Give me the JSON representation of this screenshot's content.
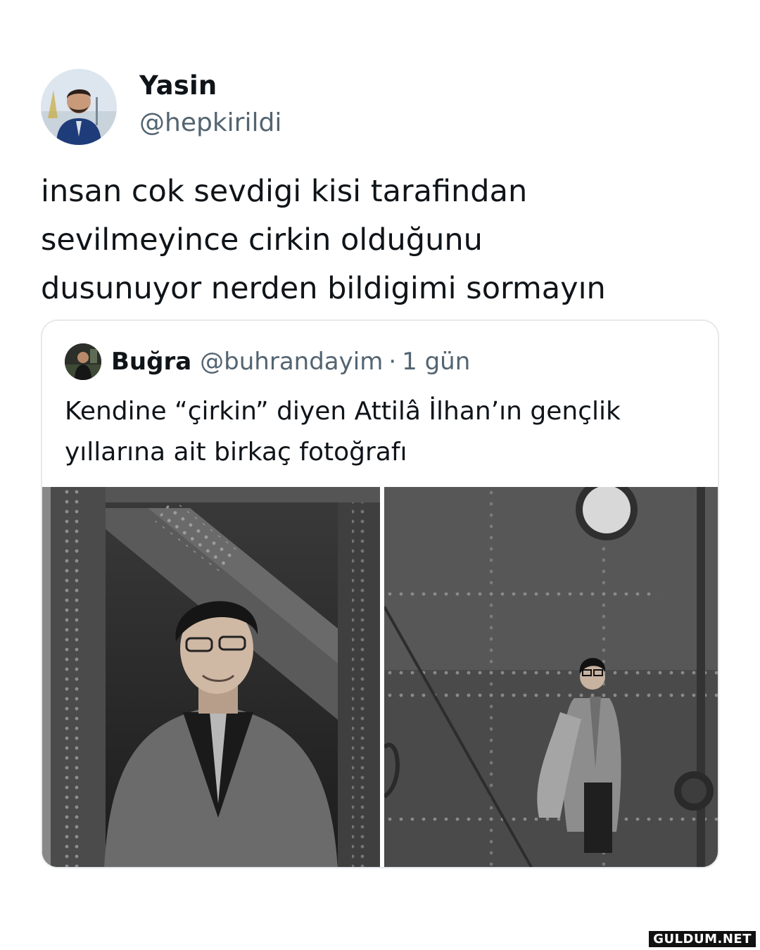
{
  "author": {
    "display_name": "Yasin",
    "handle": "@hepkirildi",
    "avatar_icon": "profile-photo"
  },
  "tweet": {
    "lines": [
      "insan cok sevdigi kisi tarafindan",
      "sevilmeyince cirkin olduğunu",
      "dusunuyor nerden bildigimi sormayın"
    ]
  },
  "quote": {
    "display_name": "Buğra",
    "handle": "@buhrandayim",
    "separator": "·",
    "time": "1 gün",
    "lines": [
      "Kendine “çirkin” diyen Attilâ İlhan’ın gençlik",
      "yıllarına ait birkaç fotoğrafı"
    ],
    "photos": [
      "bw-photo-portrait-bridge",
      "bw-photo-ship-hull"
    ]
  },
  "watermark": "GULDUM.NET",
  "colors": {
    "text": "#0f1419",
    "secondary": "#536471",
    "border": "#e6e9ec"
  }
}
